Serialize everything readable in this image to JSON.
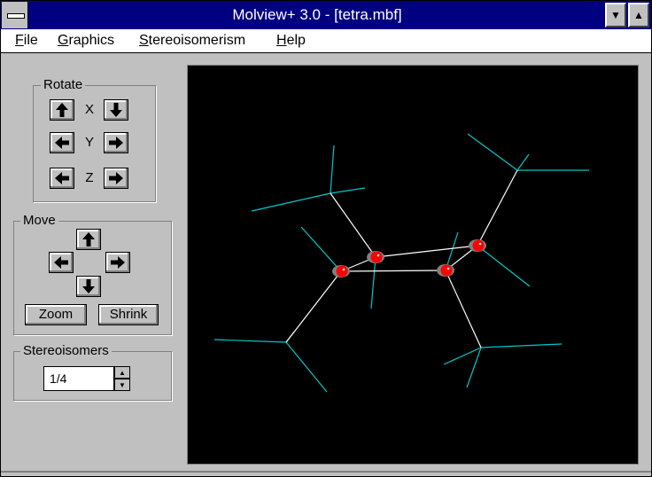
{
  "window": {
    "title": "Molview+ 3.0 - [tetra.mbf]"
  },
  "titlebar_buttons": {
    "minimize": "▼",
    "maximize": "▲"
  },
  "menu": {
    "file_u": "F",
    "file_rest": "ile",
    "graphics_u": "G",
    "graphics_rest": "raphics",
    "stereo_u": "S",
    "stereo_rest": "tereoisomerism",
    "help_u": "H",
    "help_rest": "elp"
  },
  "rotate": {
    "label": "Rotate",
    "x": "X",
    "y": "Y",
    "z": "Z"
  },
  "move": {
    "label": "Move",
    "zoom": "Zoom",
    "shrink": "Shrink"
  },
  "stereoisomers": {
    "label": "Stereoisomers",
    "value": "1/4"
  },
  "colors": {
    "atom": "#ff0000",
    "bond": "#ffffff",
    "hydrogen_bond": "#00c8c8",
    "canvas": "#000000"
  }
}
